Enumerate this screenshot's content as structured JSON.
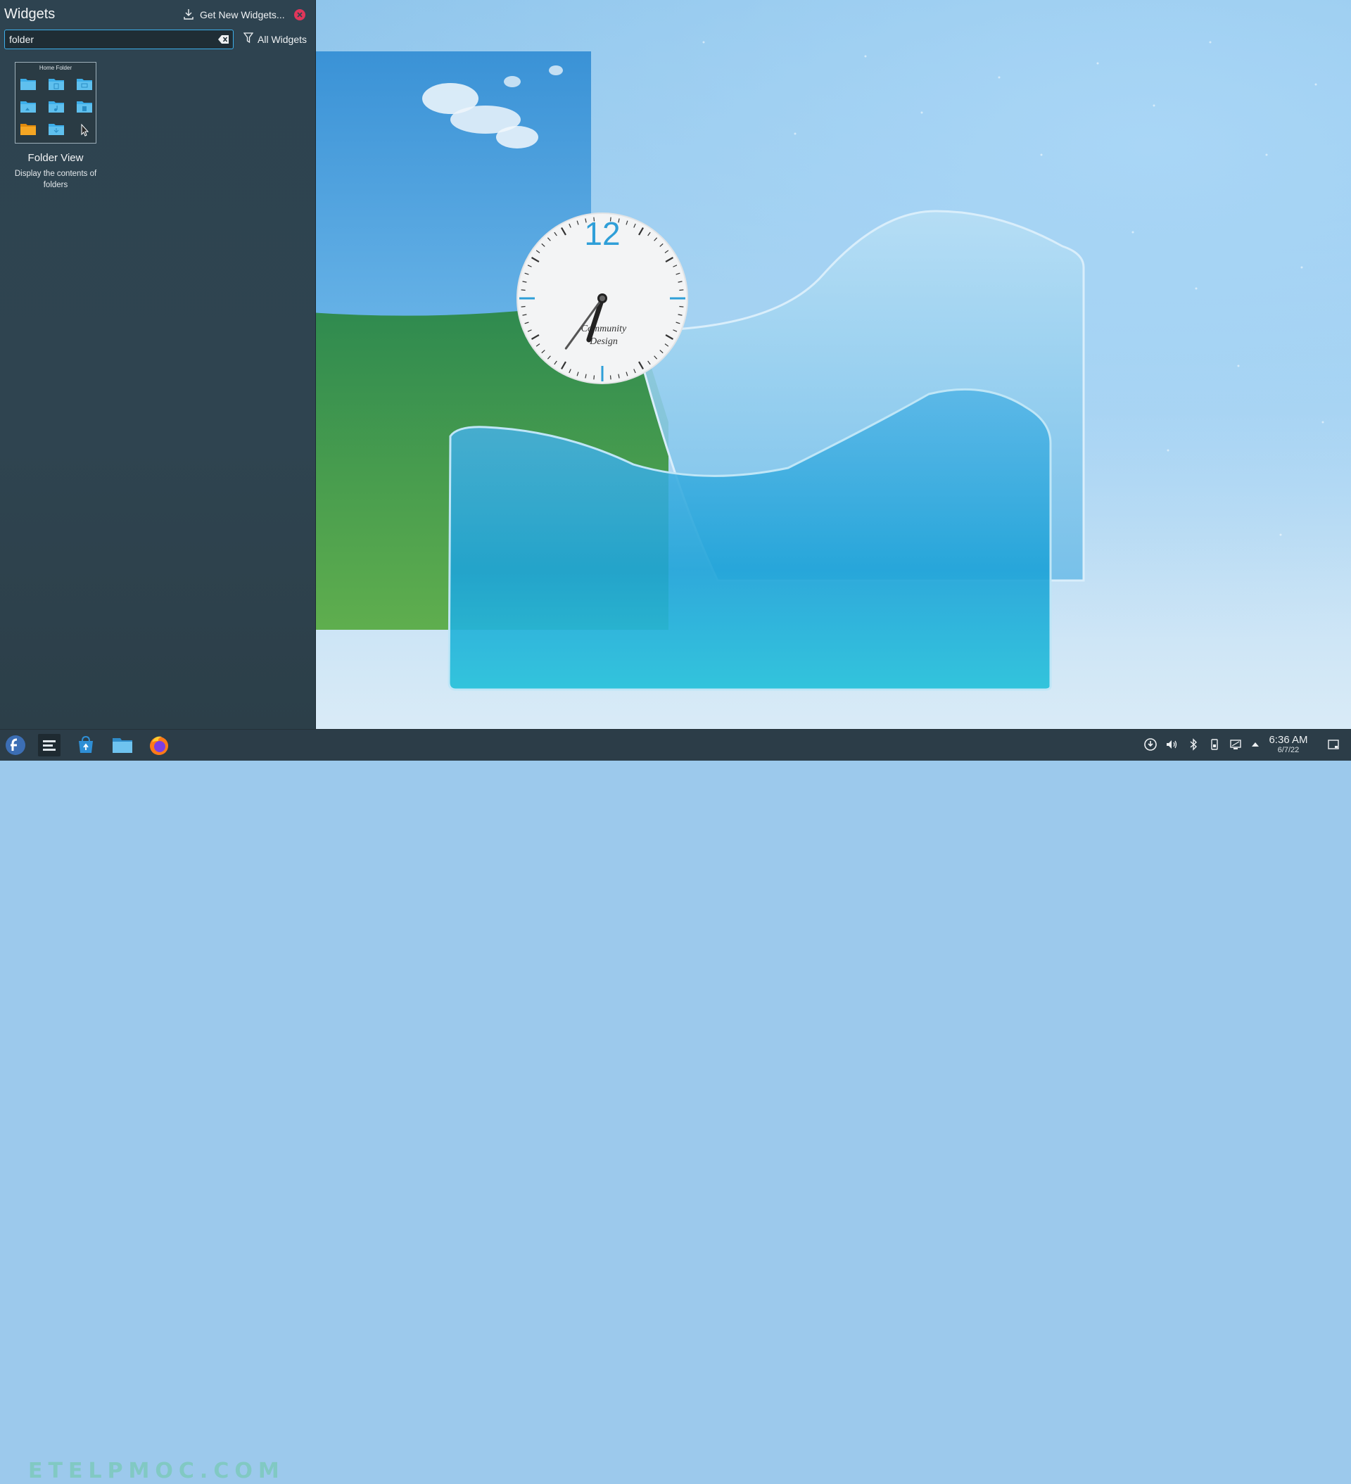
{
  "panel": {
    "title": "Widgets",
    "get_new_label": "Get New Widgets...",
    "search_value": "folder",
    "filter_label": "All Widgets"
  },
  "widget": {
    "thumb_title": "Home Folder",
    "name": "Folder View",
    "description": "Display the contents of folders"
  },
  "clock": {
    "numeral": "12",
    "brand_line1": "Community",
    "brand_line2": "Design",
    "time_shown": "6:36"
  },
  "taskbar": {
    "watermark": "ETELPMOC.COM",
    "time": "6:36 AM",
    "date": "6/7/22",
    "icons": [
      "fedora-launcher-icon",
      "pager-icon",
      "discover-store-icon",
      "file-manager-icon",
      "firefox-icon"
    ],
    "tray": [
      "updates-icon",
      "volume-icon",
      "bluetooth-icon",
      "removable-device-icon",
      "network-icon",
      "expand-tray-icon"
    ]
  },
  "colors": {
    "accent": "#3daee9",
    "panel_bg": "#2f4450",
    "close_red": "#e0365a",
    "clock_accent": "#2f9fd8"
  }
}
